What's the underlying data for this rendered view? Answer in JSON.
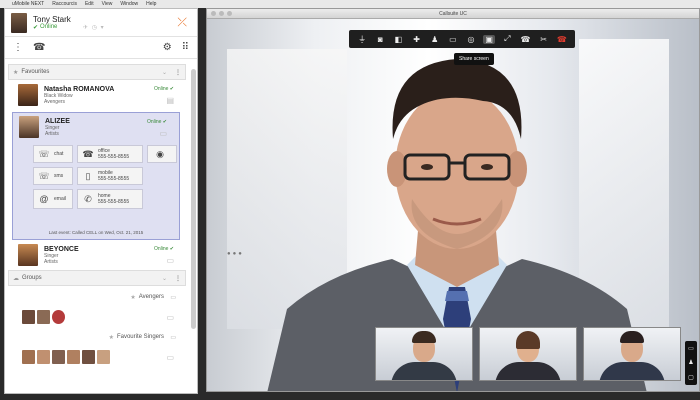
{
  "menubar": {
    "apple": "",
    "items": [
      "uMobile NEXT",
      "Raccourcis",
      "Edit",
      "View",
      "Window",
      "Help"
    ],
    "right_icons": "◔ ✉ ◐ ⚲"
  },
  "user": {
    "name": "Tony Stark",
    "status": "Online",
    "header_icons": "✈ ◷ ▾"
  },
  "favourites": {
    "label": "Favourites",
    "contacts": [
      {
        "name": "Natasha ROMANOVA",
        "title": "Black Widow",
        "group": "Avengers",
        "status": "Online ✔"
      },
      {
        "name": "ALIZEE",
        "title": "Singer",
        "group": "Artists",
        "status": "Online ✔"
      },
      {
        "name": "BEYONCE",
        "title": "Singer",
        "group": "Artists",
        "status": "Online ✔"
      }
    ],
    "expanded": {
      "chat": "chat",
      "sms": "sms",
      "email": "email",
      "office_label": "office",
      "office_num": "555-555-8555",
      "mobile_label": "mobile",
      "mobile_num": "555-555-8555",
      "home_label": "home",
      "home_num": "555-555-8555",
      "last_event": "Last event: Called CELL on Wed, Oct. 21, 2015"
    }
  },
  "groups": {
    "label": "Groups",
    "items": [
      {
        "name": "Avengers"
      },
      {
        "name": "Favourite Singers"
      }
    ]
  },
  "video_window": {
    "title": "Callsuite UC",
    "tooltip": "Share screen"
  },
  "colors": {
    "accent": "#e8732a",
    "online": "#3a9b3a",
    "hangup": "#e23b2e",
    "selected_bg": "#dfe0f2"
  }
}
